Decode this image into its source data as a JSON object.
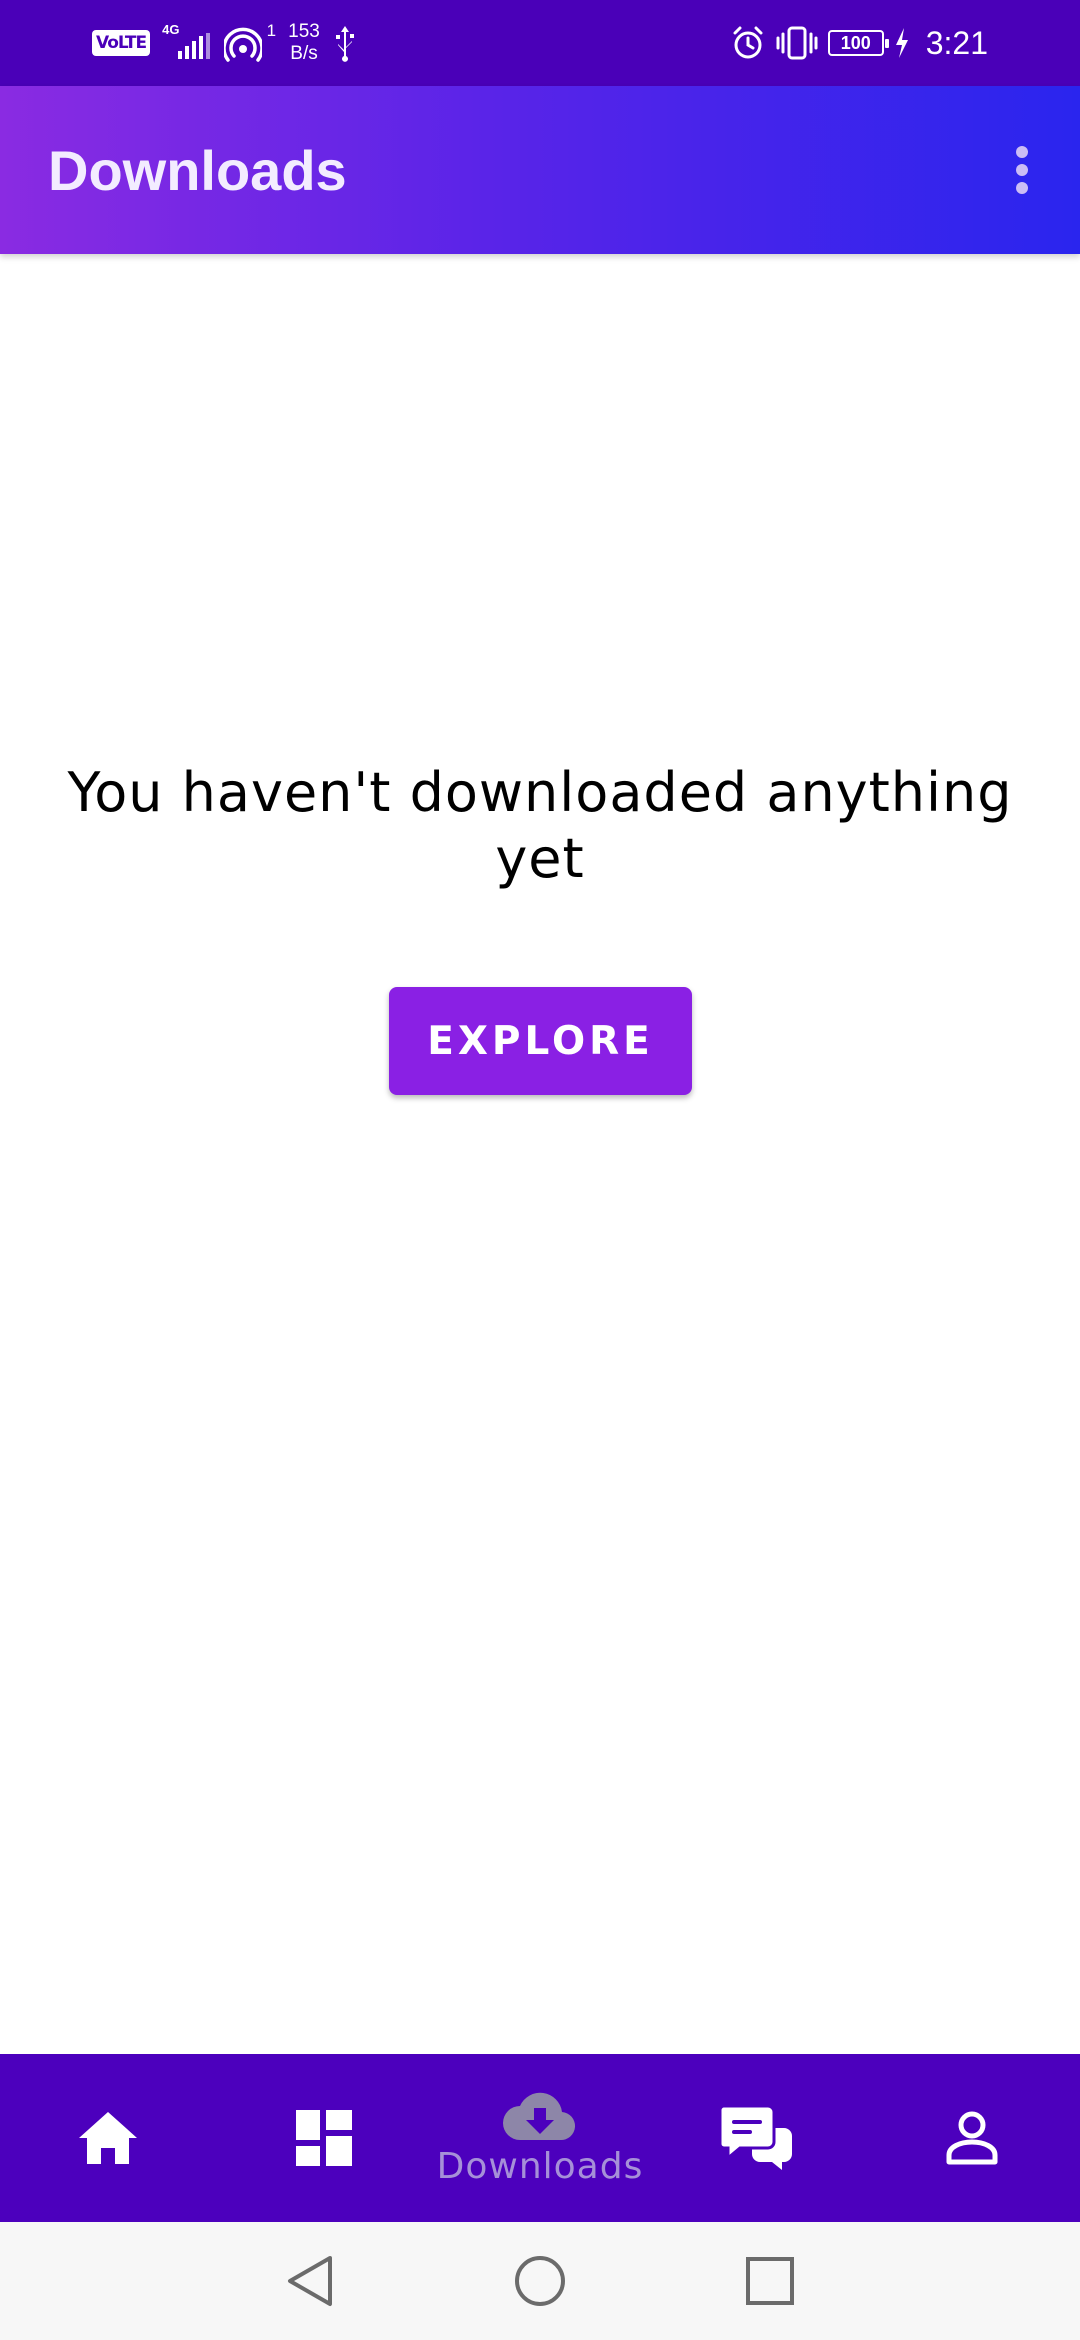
{
  "status_bar": {
    "network_badge": "VoLTE",
    "network_type": "4G",
    "hotspot_count": "1",
    "speed_value": "153",
    "speed_unit": "B/s",
    "battery": "100",
    "time": "3:21"
  },
  "app_bar": {
    "title": "Downloads",
    "menu_icon": "more-vert-icon"
  },
  "empty_state": {
    "message": "You haven't downloaded anything yet",
    "button_label": "EXPLORE"
  },
  "bottom_nav": {
    "items": [
      {
        "icon": "home-icon",
        "label": "",
        "active": false
      },
      {
        "icon": "dashboard-icon",
        "label": "",
        "active": false
      },
      {
        "icon": "cloud-download-icon",
        "label": "Downloads",
        "active": true
      },
      {
        "icon": "chat-icon",
        "label": "",
        "active": false
      },
      {
        "icon": "person-icon",
        "label": "",
        "active": false
      }
    ]
  },
  "colors": {
    "status_bar": "#4a00b8",
    "app_bar_start": "#8a2be2",
    "app_bar_end": "#2a25ee",
    "accent_button": "#8a20e4",
    "bottom_nav": "#4c00bd",
    "active_icon": "#8d86a8",
    "active_label": "#a690d8"
  }
}
